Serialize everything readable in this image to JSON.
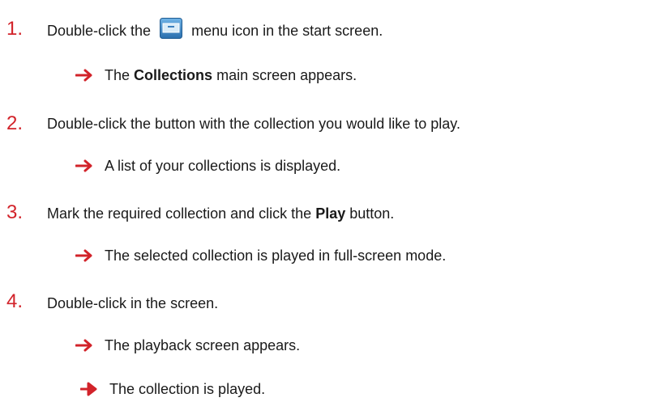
{
  "steps": [
    {
      "number": "1.",
      "text_before": "Double-click the",
      "icon": "collections-menu-icon",
      "text_after": "menu icon in the start screen.",
      "result": {
        "before": "The",
        "bold": "Collections",
        "after": "main screen appears."
      }
    },
    {
      "number": "2.",
      "text": "Double-click the button with the collection you would like to play.",
      "result": {
        "text": "A list of your collections is displayed."
      }
    },
    {
      "number": "3.",
      "text_before": "Mark the required collection and click the",
      "bold": "Play",
      "text_after": "button.",
      "result": {
        "text": "The selected collection is played in full-screen mode."
      }
    },
    {
      "number": "4.",
      "text": "Double-click in the screen.",
      "result": {
        "text": "The playback screen appears."
      }
    }
  ],
  "final_result": "The collection is played.",
  "colors": {
    "step_number": "#d2232a",
    "arrow": "#d2232a",
    "text": "#1a1a1a"
  }
}
